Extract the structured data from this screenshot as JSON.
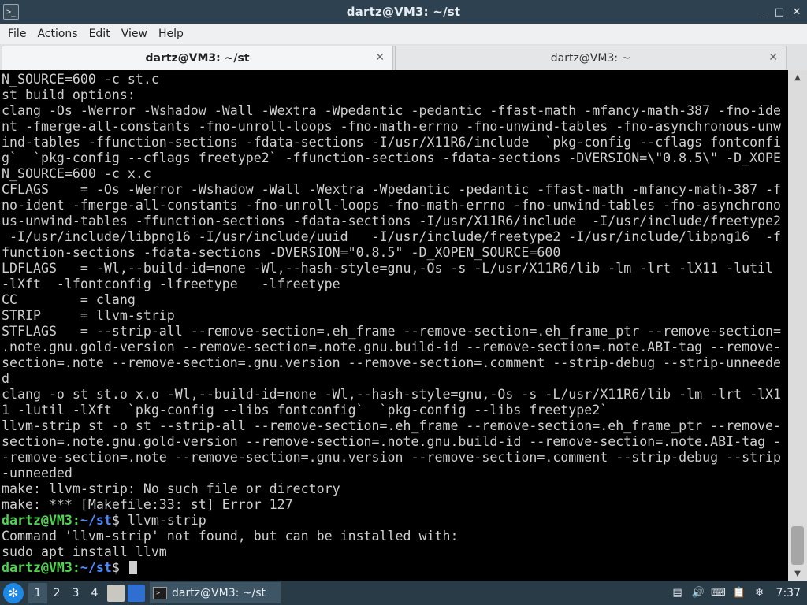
{
  "window": {
    "title": "dartz@VM3: ~/st",
    "minimize_glyph": "_",
    "maximize_glyph": "□",
    "close_glyph": "✕",
    "app_icon_glyph": ">_"
  },
  "menu": {
    "items": [
      "File",
      "Actions",
      "Edit",
      "View",
      "Help"
    ]
  },
  "tabs": [
    {
      "label": "dartz@VM3: ~/st",
      "active": true,
      "close_glyph": "✕"
    },
    {
      "label": "dartz@VM3: ~",
      "active": false,
      "close_glyph": "✕"
    }
  ],
  "terminal": {
    "lines": [
      "N_SOURCE=600 -c st.c",
      "st build options:",
      "clang -Os -Werror -Wshadow -Wall -Wextra -Wpedantic -pedantic -ffast-math -mfancy-math-387 -fno-ide",
      "nt -fmerge-all-constants -fno-unroll-loops -fno-math-errno -fno-unwind-tables -fno-asynchronous-unw",
      "ind-tables -ffunction-sections -fdata-sections -I/usr/X11R6/include  `pkg-config --cflags fontconfi",
      "g`  `pkg-config --cflags freetype2` -ffunction-sections -fdata-sections -DVERSION=\\\"0.8.5\\\" -D_XOPE",
      "N_SOURCE=600 -c x.c",
      "CFLAGS    = -Os -Werror -Wshadow -Wall -Wextra -Wpedantic -pedantic -ffast-math -mfancy-math-387 -f",
      "no-ident -fmerge-all-constants -fno-unroll-loops -fno-math-errno -fno-unwind-tables -fno-asynchrono",
      "us-unwind-tables -ffunction-sections -fdata-sections -I/usr/X11R6/include  -I/usr/include/freetype2",
      " -I/usr/include/libpng16 -I/usr/include/uuid   -I/usr/include/freetype2 -I/usr/include/libpng16  -f",
      "function-sections -fdata-sections -DVERSION=\"0.8.5\" -D_XOPEN_SOURCE=600",
      "LDFLAGS   = -Wl,--build-id=none -Wl,--hash-style=gnu,-Os -s -L/usr/X11R6/lib -lm -lrt -lX11 -lutil",
      "-lXft  -lfontconfig -lfreetype   -lfreetype",
      "CC        = clang",
      "STRIP     = llvm-strip",
      "STFLAGS   = --strip-all --remove-section=.eh_frame --remove-section=.eh_frame_ptr --remove-section=",
      ".note.gnu.gold-version --remove-section=.note.gnu.build-id --remove-section=.note.ABI-tag --remove-",
      "section=.note --remove-section=.gnu.version --remove-section=.comment --strip-debug --strip-unneede",
      "d",
      "clang -o st st.o x.o -Wl,--build-id=none -Wl,--hash-style=gnu,-Os -s -L/usr/X11R6/lib -lm -lrt -lX1",
      "1 -lutil -lXft  `pkg-config --libs fontconfig`  `pkg-config --libs freetype2`",
      "llvm-strip st -o st --strip-all --remove-section=.eh_frame --remove-section=.eh_frame_ptr --remove-",
      "section=.note.gnu.gold-version --remove-section=.note.gnu.build-id --remove-section=.note.ABI-tag -",
      "-remove-section=.note --remove-section=.gnu.version --remove-section=.comment --strip-debug --strip",
      "-unneeded",
      "make: llvm-strip: No such file or directory",
      "make: *** [Makefile:33: st] Error 127"
    ],
    "prompt_user": "dartz@VM3",
    "prompt_sep": ":",
    "prompt_path": "~/st",
    "prompt_symbol": "$",
    "command": " llvm-strip",
    "output_lines": [
      "Command 'llvm-strip' not found, but can be installed with:",
      "sudo apt install llvm"
    ],
    "final_prompt_user": "dartz@VM3",
    "final_prompt_sep": ":",
    "final_prompt_path": "~/st",
    "final_prompt_symbol": "$ ",
    "scroll_position": 1.0,
    "scroll_visible_fraction": 0.08
  },
  "taskbar": {
    "start_glyph": "✻",
    "workspaces": [
      "1",
      "2",
      "3",
      "4"
    ],
    "active_workspace": "1",
    "task_label": "dartz@VM3: ~/st",
    "task_icon_glyph": ">_",
    "tray_icons": [
      "▤",
      "🔊",
      "⌨",
      "📋",
      "❄"
    ],
    "clock": "7:37"
  }
}
